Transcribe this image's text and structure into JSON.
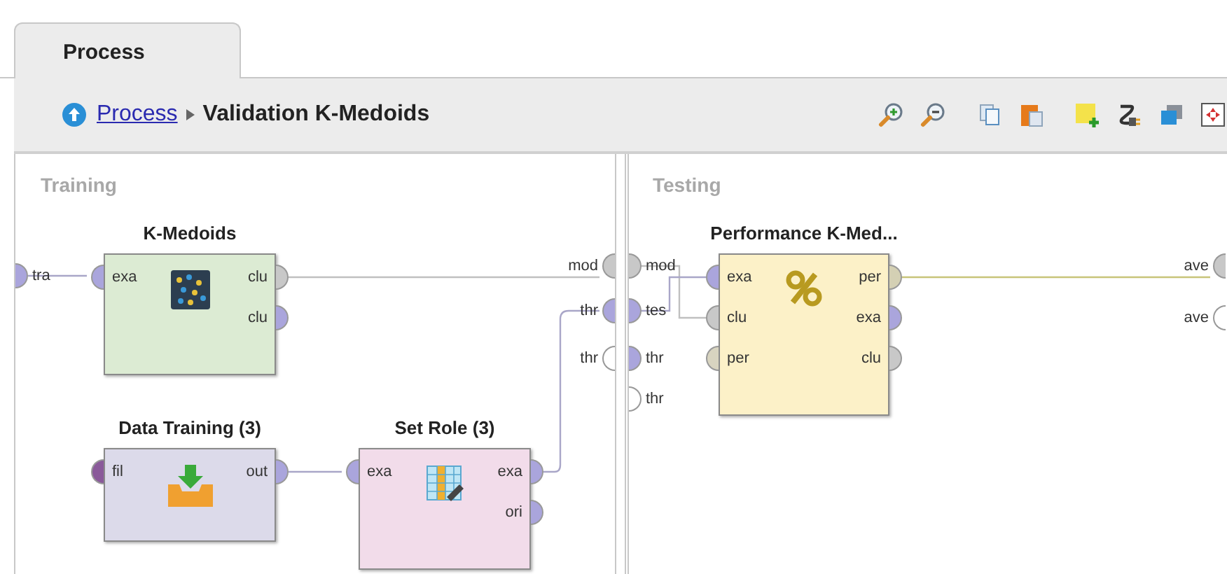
{
  "tabs": [
    {
      "label": "Process",
      "selected": true
    }
  ],
  "breadcrumb": {
    "link": "Process",
    "current": "Validation K-Medoids"
  },
  "panels": [
    {
      "title": "Training",
      "left_ports": [
        {
          "label": "tra",
          "color": "#aaa5dc"
        }
      ],
      "right_ports": [
        {
          "label": "mod",
          "color": "#c8c8c8"
        },
        {
          "label": "thr",
          "color": "#aaa5dc"
        },
        {
          "label": "thr",
          "color": "#ffffff"
        }
      ],
      "nodes": [
        {
          "title": "K-Medoids",
          "color": "#dcebd3",
          "kind": "clusters",
          "inputs": [
            {
              "label": "exa",
              "color": "#aaa5dc"
            }
          ],
          "outputs": [
            {
              "label": "clu",
              "color": "#c8c8c8"
            },
            {
              "label": "clu",
              "color": "#aaa5dc"
            }
          ]
        },
        {
          "title": "Data Training (3)",
          "color": "#dcdaea",
          "kind": "import",
          "inputs": [
            {
              "label": "fil",
              "color": "#8a5a9a"
            }
          ],
          "outputs": [
            {
              "label": "out",
              "color": "#aaa5dc"
            }
          ]
        },
        {
          "title": "Set Role (3)",
          "color": "#f2dcea",
          "kind": "table",
          "inputs": [
            {
              "label": "exa",
              "color": "#aaa5dc"
            }
          ],
          "outputs": [
            {
              "label": "exa",
              "color": "#aaa5dc"
            },
            {
              "label": "ori",
              "color": "#aaa5dc"
            }
          ]
        }
      ]
    },
    {
      "title": "Testing",
      "left_ports": [
        {
          "label": "mod",
          "color": "#c8c8c8"
        },
        {
          "label": "tes",
          "color": "#aaa5dc"
        },
        {
          "label": "thr",
          "color": "#aaa5dc"
        },
        {
          "label": "thr",
          "color": "#ffffff"
        }
      ],
      "right_ports": [
        {
          "label": "ave",
          "color": "#c8c8c8"
        },
        {
          "label": "ave",
          "color": "#ffffff"
        }
      ],
      "nodes": [
        {
          "title": "Performance K-Med...",
          "color": "#fcf1c8",
          "kind": "percent",
          "inputs": [
            {
              "label": "exa",
              "color": "#aaa5dc"
            },
            {
              "label": "clu",
              "color": "#c8c8c8"
            },
            {
              "label": "per",
              "color": "#d8d4c0"
            }
          ],
          "outputs": [
            {
              "label": "per",
              "color": "#d4d0b4"
            },
            {
              "label": "exa",
              "color": "#aaa5dc"
            },
            {
              "label": "clu",
              "color": "#c8c8c8"
            }
          ]
        }
      ]
    }
  ]
}
